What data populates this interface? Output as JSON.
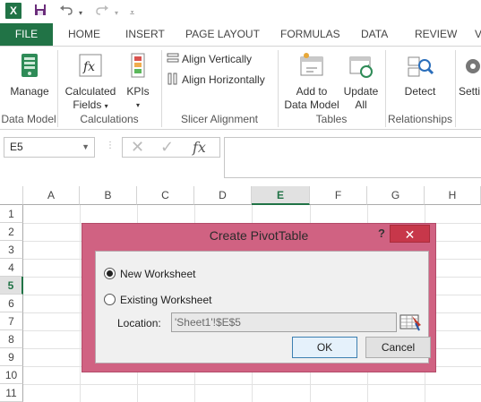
{
  "qat": {
    "app_icon": "X",
    "save_icon": "save-icon",
    "undo_icon": "undo-icon",
    "redo_icon": "redo-icon"
  },
  "tabs": [
    "FILE",
    "HOME",
    "INSERT",
    "PAGE LAYOUT",
    "FORMULAS",
    "DATA",
    "REVIEW",
    "V"
  ],
  "ribbon": {
    "manage_label": "Manage",
    "calculated_fields_label_1": "Calculated",
    "calculated_fields_label_2": "Fields",
    "kpis_label": "KPIs",
    "align_vertically_label": "Align Vertically",
    "align_horizontally_label": "Align Horizontally",
    "add_to_data_model_label_1": "Add to",
    "add_to_data_model_label_2": "Data Model",
    "update_all_label_1": "Update",
    "update_all_label_2": "All",
    "detect_label": "Detect",
    "settings_label": "Setti",
    "groups": {
      "data_model": "Data Model",
      "calculations": "Calculations",
      "slicer_alignment": "Slicer Alignment",
      "tables": "Tables",
      "relationships": "Relationships"
    }
  },
  "formula_bar": {
    "name_box": "E5",
    "fx": "fx"
  },
  "grid": {
    "columns": [
      "A",
      "B",
      "C",
      "D",
      "E",
      "F",
      "G",
      "H"
    ],
    "rows": [
      "1",
      "2",
      "3",
      "4",
      "5",
      "6",
      "7",
      "8",
      "9",
      "10",
      "11"
    ],
    "selected_column": "E",
    "selected_row": "5"
  },
  "dialog": {
    "title": "Create PivotTable",
    "help": "?",
    "close": "✕",
    "new_worksheet_label": "New Worksheet",
    "existing_worksheet_label": "Existing Worksheet",
    "location_label": "Location:",
    "location_value": "'Sheet1'!$E$5",
    "ok_label": "OK",
    "cancel_label": "Cancel",
    "selected_option": "New Worksheet"
  },
  "colors": {
    "excel_green": "#217346",
    "dialog_accent": "#d06282",
    "close_red": "#c7374a"
  }
}
